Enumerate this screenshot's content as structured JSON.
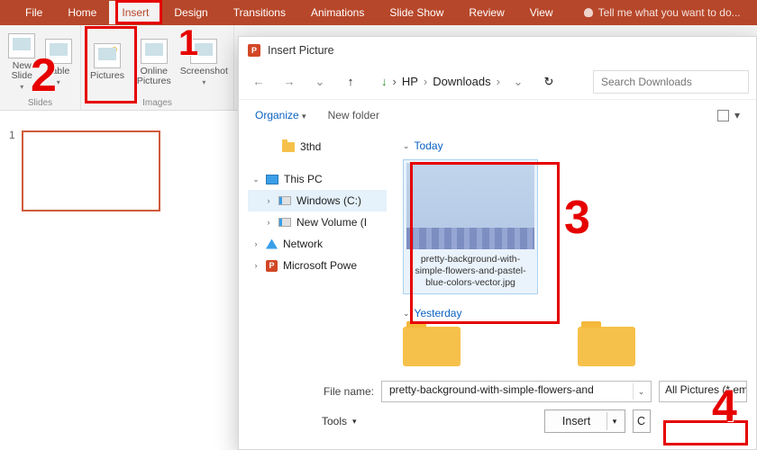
{
  "ribbon": {
    "tabs": [
      "File",
      "Home",
      "Insert",
      "Design",
      "Transitions",
      "Animations",
      "Slide Show",
      "Review",
      "View"
    ],
    "active_tab_index": 2,
    "tell_me": "Tell me what you want to do...",
    "groups": {
      "slides": {
        "label": "Slides",
        "new_slide": "New Slide",
        "table": "Table"
      },
      "images": {
        "label": "Images",
        "pictures": "Pictures",
        "online_pictures": "Online Pictures",
        "screenshot": "Screenshot"
      }
    }
  },
  "slides": {
    "thumbs": [
      {
        "number": "1"
      }
    ]
  },
  "dialog": {
    "title": "Insert Picture",
    "nav": {
      "breadcrumb": [
        "HP",
        "Downloads"
      ],
      "search_placeholder": "Search Downloads"
    },
    "toolbar": {
      "organize": "Organize",
      "new_folder": "New folder"
    },
    "tree": [
      {
        "label": "3thd",
        "icon": "folder",
        "indent": 1
      },
      {
        "label": "This PC",
        "icon": "pc",
        "expand": "open",
        "indent": 0
      },
      {
        "label": "Windows (C:)",
        "icon": "disk-win",
        "expand": "open",
        "indent": 1,
        "selected": true
      },
      {
        "label": "New Volume (I",
        "icon": "disk",
        "expand": "closed",
        "indent": 1
      },
      {
        "label": "Network",
        "icon": "net",
        "expand": "closed",
        "indent": 0
      },
      {
        "label": "Microsoft Powe",
        "icon": "ppt",
        "expand": "closed",
        "indent": 0
      }
    ],
    "files": {
      "today": {
        "heading": "Today",
        "items": [
          {
            "caption": "pretty-background-with-simple-flowers-and-pastel-blue-colors-vector.jpg"
          }
        ]
      },
      "yesterday": {
        "heading": "Yesterday"
      }
    },
    "bottom": {
      "file_name_label": "File name:",
      "file_name_value": "pretty-background-with-simple-flowers-and",
      "filter": "All Pictures (*.emf;*.wm",
      "tools": "Tools",
      "insert": "Insert",
      "cancel": "C"
    }
  },
  "annotations": {
    "n1": "1",
    "n2": "2",
    "n3": "3",
    "n4": "4"
  }
}
